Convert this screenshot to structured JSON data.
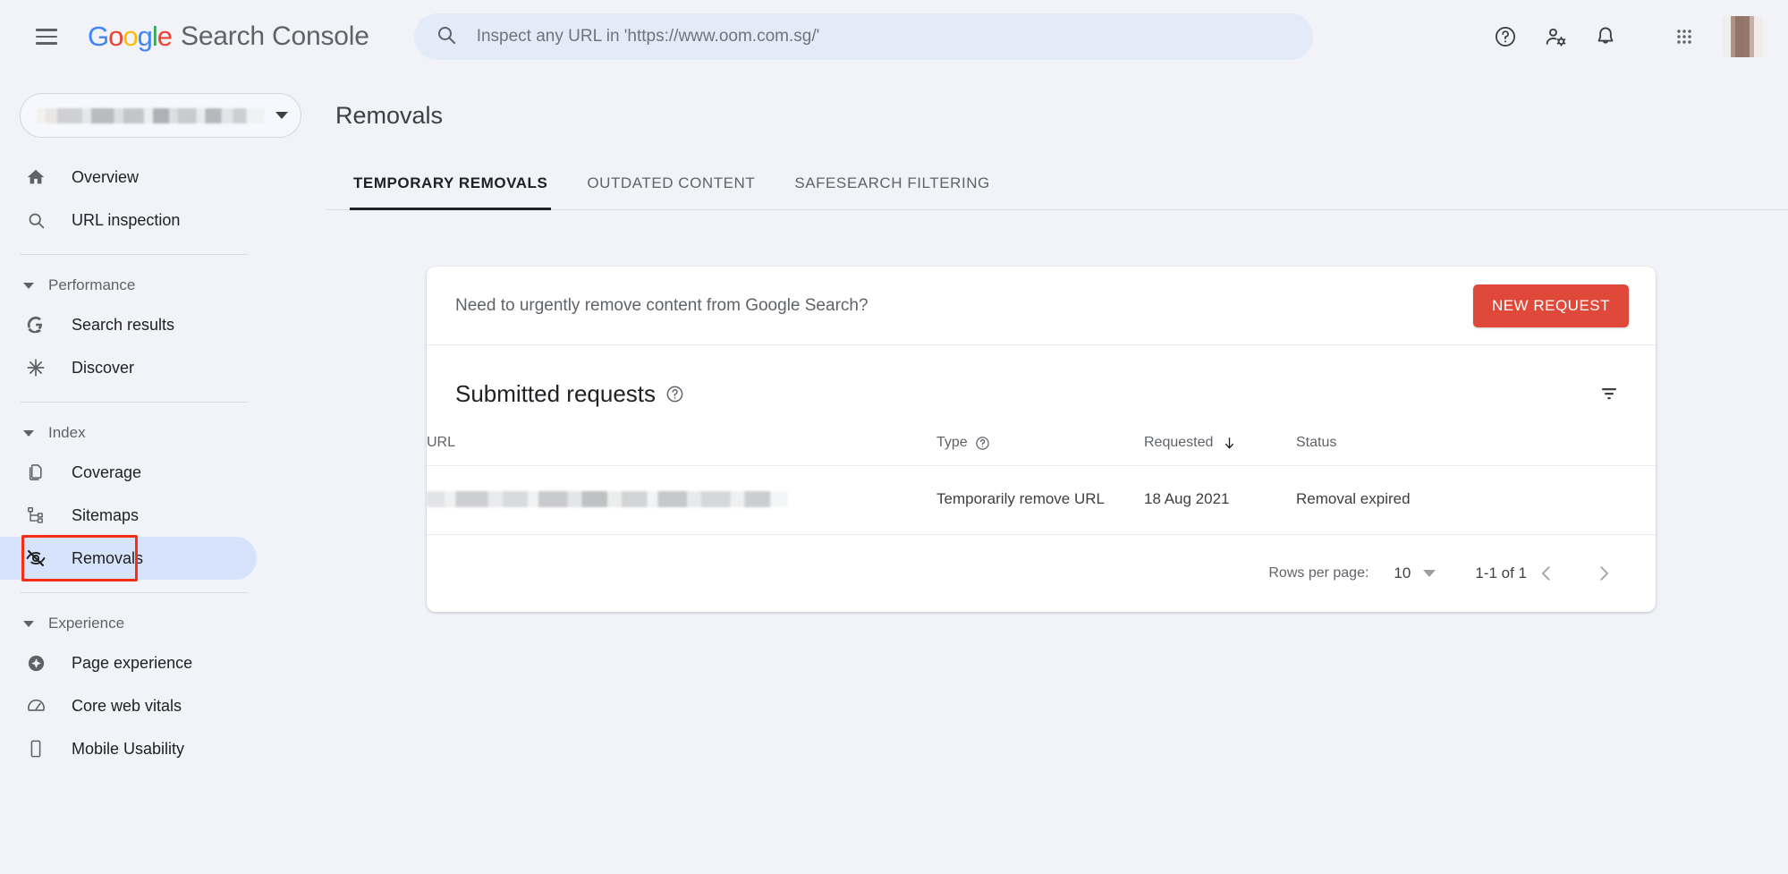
{
  "topbar": {
    "menu_icon": "hamburger-menu-icon",
    "brand_google": "Google",
    "brand_product": "Search Console",
    "search_placeholder": "Inspect any URL in 'https://www.oom.com.sg/'",
    "search_value": "",
    "search_icon": "search-icon",
    "help_icon": "help-circle-icon",
    "user_settings_icon": "person-gear-icon",
    "notifications_icon": "bell-icon",
    "apps_icon": "apps-grid-icon",
    "avatar_label": "account-avatar"
  },
  "sidebar": {
    "property_selector_label": "",
    "items": [
      {
        "label": "Overview",
        "icon": "home-icon",
        "active": false
      },
      {
        "label": "URL inspection",
        "icon": "search-icon",
        "active": false
      }
    ],
    "groups": [
      {
        "title": "Performance",
        "items": [
          {
            "label": "Search results",
            "icon": "google-g-icon",
            "active": false
          },
          {
            "label": "Discover",
            "icon": "discover-asterisk-icon",
            "active": false
          }
        ]
      },
      {
        "title": "Index",
        "items": [
          {
            "label": "Coverage",
            "icon": "pages-copy-icon",
            "active": false
          },
          {
            "label": "Sitemaps",
            "icon": "sitemap-tree-icon",
            "active": false
          },
          {
            "label": "Removals",
            "icon": "eye-off-icon",
            "active": true
          }
        ]
      },
      {
        "title": "Experience",
        "items": [
          {
            "label": "Page experience",
            "icon": "page-experience-icon",
            "active": false
          },
          {
            "label": "Core web vitals",
            "icon": "speedometer-icon",
            "active": false
          },
          {
            "label": "Mobile Usability",
            "icon": "mobile-phone-icon",
            "active": false
          }
        ]
      }
    ]
  },
  "main": {
    "page_title": "Removals",
    "tabs": [
      {
        "label": "TEMPORARY REMOVALS",
        "active": true
      },
      {
        "label": "OUTDATED CONTENT",
        "active": false
      },
      {
        "label": "SAFESEARCH FILTERING",
        "active": false
      }
    ],
    "urgent_banner": {
      "text": "Need to urgently remove content from Google Search?",
      "button_label": "NEW REQUEST"
    },
    "submitted": {
      "title": "Submitted requests",
      "help_icon": "help-circle-icon",
      "filter_icon": "filter-list-icon",
      "columns": [
        "URL",
        "Type",
        "Requested",
        "Status"
      ],
      "sort_column": "Requested",
      "sort_direction": "descending",
      "rows": [
        {
          "url": "",
          "type": "Temporarily remove URL",
          "requested": "18 Aug 2021",
          "status": "Removal expired"
        }
      ]
    },
    "pagination": {
      "rows_per_page_label": "Rows per page:",
      "rows_per_page_value": "10",
      "range_label": "1-1 of 1",
      "prev_icon": "chevron-left-icon",
      "next_icon": "chevron-right-icon"
    }
  },
  "colors": {
    "page_background": "#f1f3f9",
    "accent_red": "#e0483a",
    "active_nav": "#d7e3fb",
    "highlight_box": "#f42f14",
    "search_field": "#e3eaf8"
  }
}
